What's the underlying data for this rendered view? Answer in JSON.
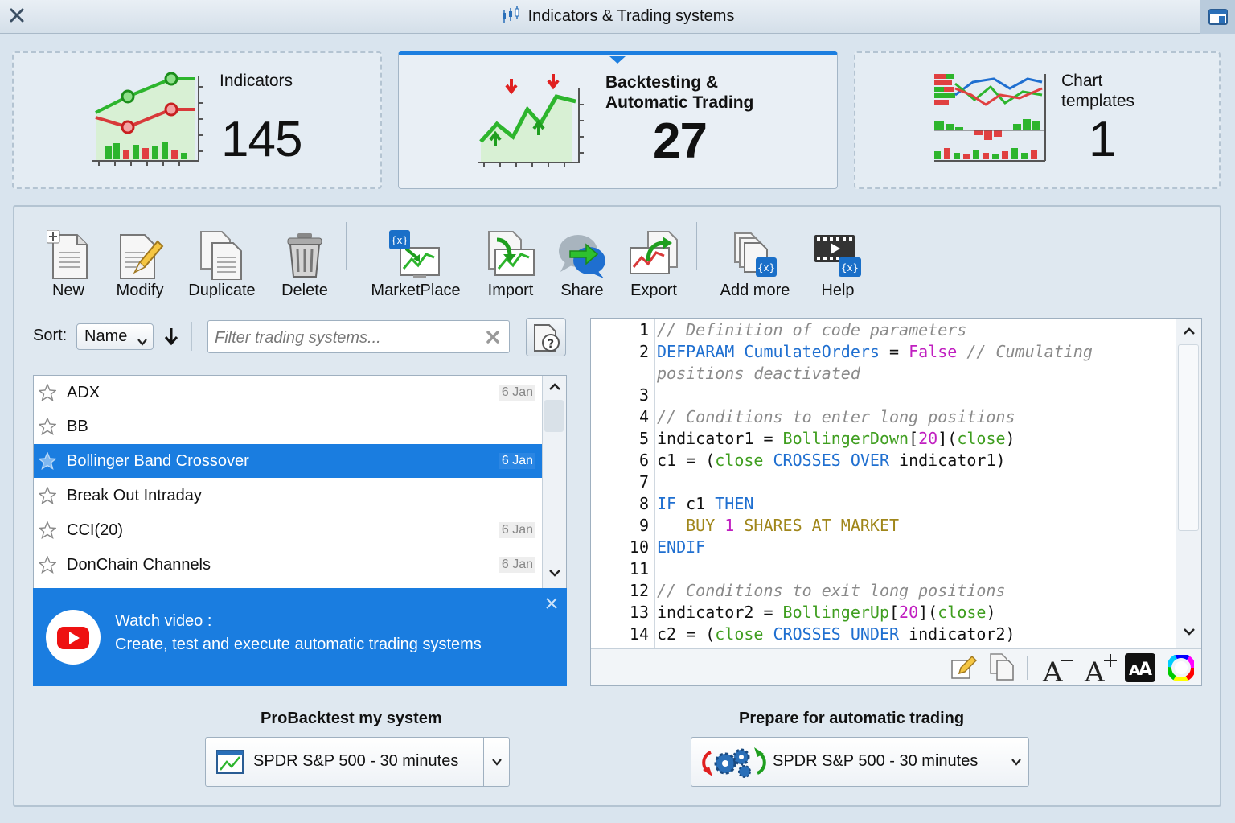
{
  "window": {
    "title": "Indicators & Trading systems"
  },
  "cards": {
    "indicators": {
      "label": "Indicators",
      "count": "145"
    },
    "backtesting": {
      "label_line1": "Backtesting &",
      "label_line2": "Automatic Trading",
      "count": "27"
    },
    "templates": {
      "label_line1": "Chart",
      "label_line2": "templates",
      "count": "1"
    }
  },
  "toolbar": {
    "new": "New",
    "modify": "Modify",
    "duplicate": "Duplicate",
    "delete": "Delete",
    "marketplace": "MarketPlace",
    "import": "Import",
    "share": "Share",
    "export": "Export",
    "add_more": "Add more",
    "help": "Help"
  },
  "sort": {
    "label": "Sort:",
    "value": "Name"
  },
  "filter": {
    "placeholder": "Filter trading systems..."
  },
  "systems": [
    {
      "name": "ADX",
      "date": "6 Jan",
      "selected": false
    },
    {
      "name": "BB",
      "date": "",
      "selected": false
    },
    {
      "name": "Bollinger Band Crossover",
      "date": "6 Jan",
      "selected": true
    },
    {
      "name": "Break Out Intraday",
      "date": "",
      "selected": false
    },
    {
      "name": "CCI(20)",
      "date": "6 Jan",
      "selected": false
    },
    {
      "name": "DonChain Channels",
      "date": "6 Jan",
      "selected": false
    }
  ],
  "video": {
    "title": "Watch video :",
    "subtitle": "Create, test and execute automatic trading systems"
  },
  "code": {
    "line_numbers": [
      "1",
      "2",
      "",
      "3",
      "4",
      "5",
      "6",
      "7",
      "8",
      "9",
      "10",
      "11",
      "12",
      "13",
      "14"
    ]
  },
  "backtest": {
    "heading": "ProBacktest my system",
    "value": "SPDR S&P 500 - 30 minutes"
  },
  "autotrade": {
    "heading": "Prepare for automatic trading",
    "value": "SPDR S&P 500 - 30 minutes"
  },
  "colors": {
    "accent": "#1a7de0",
    "background": "#d9e4ee",
    "keyword": "#1f6fd0",
    "comment": "#8a8a8a",
    "function": "#3f9e1f",
    "number": "#c01fc0",
    "order": "#a0861a"
  }
}
